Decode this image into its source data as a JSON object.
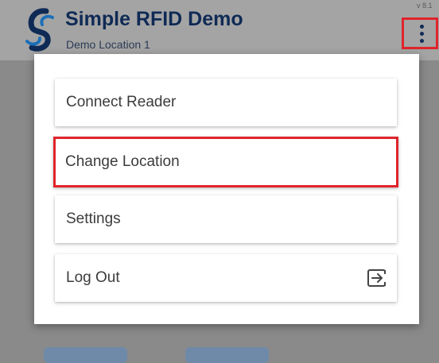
{
  "header": {
    "title": "Simple RFID Demo",
    "subtitle": "Demo Location 1",
    "version": "v 8.1",
    "logo_icon": "app-logo-icon",
    "menu_icon": "more-vertical-icon"
  },
  "menu": {
    "items": [
      {
        "label": "Connect Reader"
      },
      {
        "label": "Change Location",
        "highlighted": true
      },
      {
        "label": "Settings"
      },
      {
        "label": "Log Out",
        "icon": "log-out-icon"
      }
    ]
  },
  "colors": {
    "brand_navy": "#0f2a55",
    "highlight_red": "#e0242b",
    "overlay_gray": "#8a8a8a",
    "header_gray": "#a4a4a4"
  }
}
